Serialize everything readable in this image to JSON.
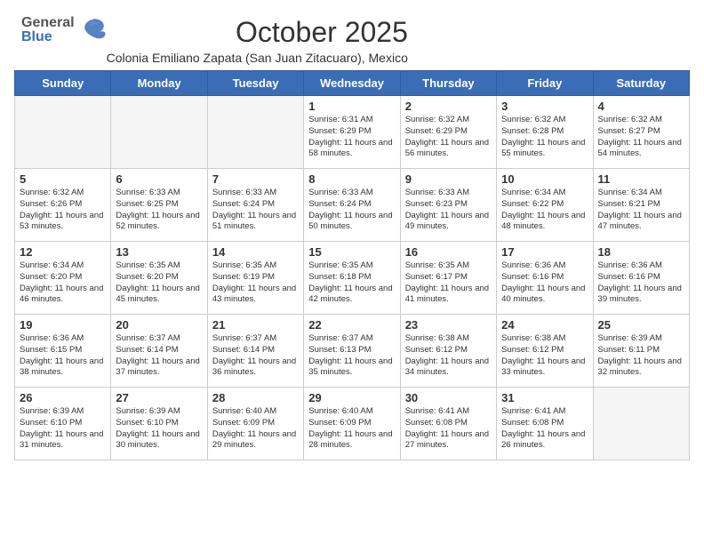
{
  "header": {
    "logo_general": "General",
    "logo_blue": "Blue",
    "month_year": "October 2025",
    "location": "Colonia Emiliano Zapata (San Juan Zitacuaro), Mexico"
  },
  "days_of_week": [
    "Sunday",
    "Monday",
    "Tuesday",
    "Wednesday",
    "Thursday",
    "Friday",
    "Saturday"
  ],
  "weeks": [
    [
      {
        "date": "",
        "empty": true
      },
      {
        "date": "",
        "empty": true
      },
      {
        "date": "",
        "empty": true
      },
      {
        "date": "1",
        "sunrise": "6:31 AM",
        "sunset": "6:29 PM",
        "daylight": "11 hours and 58 minutes."
      },
      {
        "date": "2",
        "sunrise": "6:32 AM",
        "sunset": "6:29 PM",
        "daylight": "11 hours and 56 minutes."
      },
      {
        "date": "3",
        "sunrise": "6:32 AM",
        "sunset": "6:28 PM",
        "daylight": "11 hours and 55 minutes."
      },
      {
        "date": "4",
        "sunrise": "6:32 AM",
        "sunset": "6:27 PM",
        "daylight": "11 hours and 54 minutes."
      }
    ],
    [
      {
        "date": "5",
        "sunrise": "6:32 AM",
        "sunset": "6:26 PM",
        "daylight": "11 hours and 53 minutes."
      },
      {
        "date": "6",
        "sunrise": "6:33 AM",
        "sunset": "6:25 PM",
        "daylight": "11 hours and 52 minutes."
      },
      {
        "date": "7",
        "sunrise": "6:33 AM",
        "sunset": "6:24 PM",
        "daylight": "11 hours and 51 minutes."
      },
      {
        "date": "8",
        "sunrise": "6:33 AM",
        "sunset": "6:24 PM",
        "daylight": "11 hours and 50 minutes."
      },
      {
        "date": "9",
        "sunrise": "6:33 AM",
        "sunset": "6:23 PM",
        "daylight": "11 hours and 49 minutes."
      },
      {
        "date": "10",
        "sunrise": "6:34 AM",
        "sunset": "6:22 PM",
        "daylight": "11 hours and 48 minutes."
      },
      {
        "date": "11",
        "sunrise": "6:34 AM",
        "sunset": "6:21 PM",
        "daylight": "11 hours and 47 minutes."
      }
    ],
    [
      {
        "date": "12",
        "sunrise": "6:34 AM",
        "sunset": "6:20 PM",
        "daylight": "11 hours and 46 minutes."
      },
      {
        "date": "13",
        "sunrise": "6:35 AM",
        "sunset": "6:20 PM",
        "daylight": "11 hours and 45 minutes."
      },
      {
        "date": "14",
        "sunrise": "6:35 AM",
        "sunset": "6:19 PM",
        "daylight": "11 hours and 43 minutes."
      },
      {
        "date": "15",
        "sunrise": "6:35 AM",
        "sunset": "6:18 PM",
        "daylight": "11 hours and 42 minutes."
      },
      {
        "date": "16",
        "sunrise": "6:35 AM",
        "sunset": "6:17 PM",
        "daylight": "11 hours and 41 minutes."
      },
      {
        "date": "17",
        "sunrise": "6:36 AM",
        "sunset": "6:16 PM",
        "daylight": "11 hours and 40 minutes."
      },
      {
        "date": "18",
        "sunrise": "6:36 AM",
        "sunset": "6:16 PM",
        "daylight": "11 hours and 39 minutes."
      }
    ],
    [
      {
        "date": "19",
        "sunrise": "6:36 AM",
        "sunset": "6:15 PM",
        "daylight": "11 hours and 38 minutes."
      },
      {
        "date": "20",
        "sunrise": "6:37 AM",
        "sunset": "6:14 PM",
        "daylight": "11 hours and 37 minutes."
      },
      {
        "date": "21",
        "sunrise": "6:37 AM",
        "sunset": "6:14 PM",
        "daylight": "11 hours and 36 minutes."
      },
      {
        "date": "22",
        "sunrise": "6:37 AM",
        "sunset": "6:13 PM",
        "daylight": "11 hours and 35 minutes."
      },
      {
        "date": "23",
        "sunrise": "6:38 AM",
        "sunset": "6:12 PM",
        "daylight": "11 hours and 34 minutes."
      },
      {
        "date": "24",
        "sunrise": "6:38 AM",
        "sunset": "6:12 PM",
        "daylight": "11 hours and 33 minutes."
      },
      {
        "date": "25",
        "sunrise": "6:39 AM",
        "sunset": "6:11 PM",
        "daylight": "11 hours and 32 minutes."
      }
    ],
    [
      {
        "date": "26",
        "sunrise": "6:39 AM",
        "sunset": "6:10 PM",
        "daylight": "11 hours and 31 minutes."
      },
      {
        "date": "27",
        "sunrise": "6:39 AM",
        "sunset": "6:10 PM",
        "daylight": "11 hours and 30 minutes."
      },
      {
        "date": "28",
        "sunrise": "6:40 AM",
        "sunset": "6:09 PM",
        "daylight": "11 hours and 29 minutes."
      },
      {
        "date": "29",
        "sunrise": "6:40 AM",
        "sunset": "6:09 PM",
        "daylight": "11 hours and 28 minutes."
      },
      {
        "date": "30",
        "sunrise": "6:41 AM",
        "sunset": "6:08 PM",
        "daylight": "11 hours and 27 minutes."
      },
      {
        "date": "31",
        "sunrise": "6:41 AM",
        "sunset": "6:08 PM",
        "daylight": "11 hours and 26 minutes."
      },
      {
        "date": "",
        "empty": true
      }
    ]
  ],
  "labels": {
    "sunrise": "Sunrise:",
    "sunset": "Sunset:",
    "daylight": "Daylight:"
  }
}
